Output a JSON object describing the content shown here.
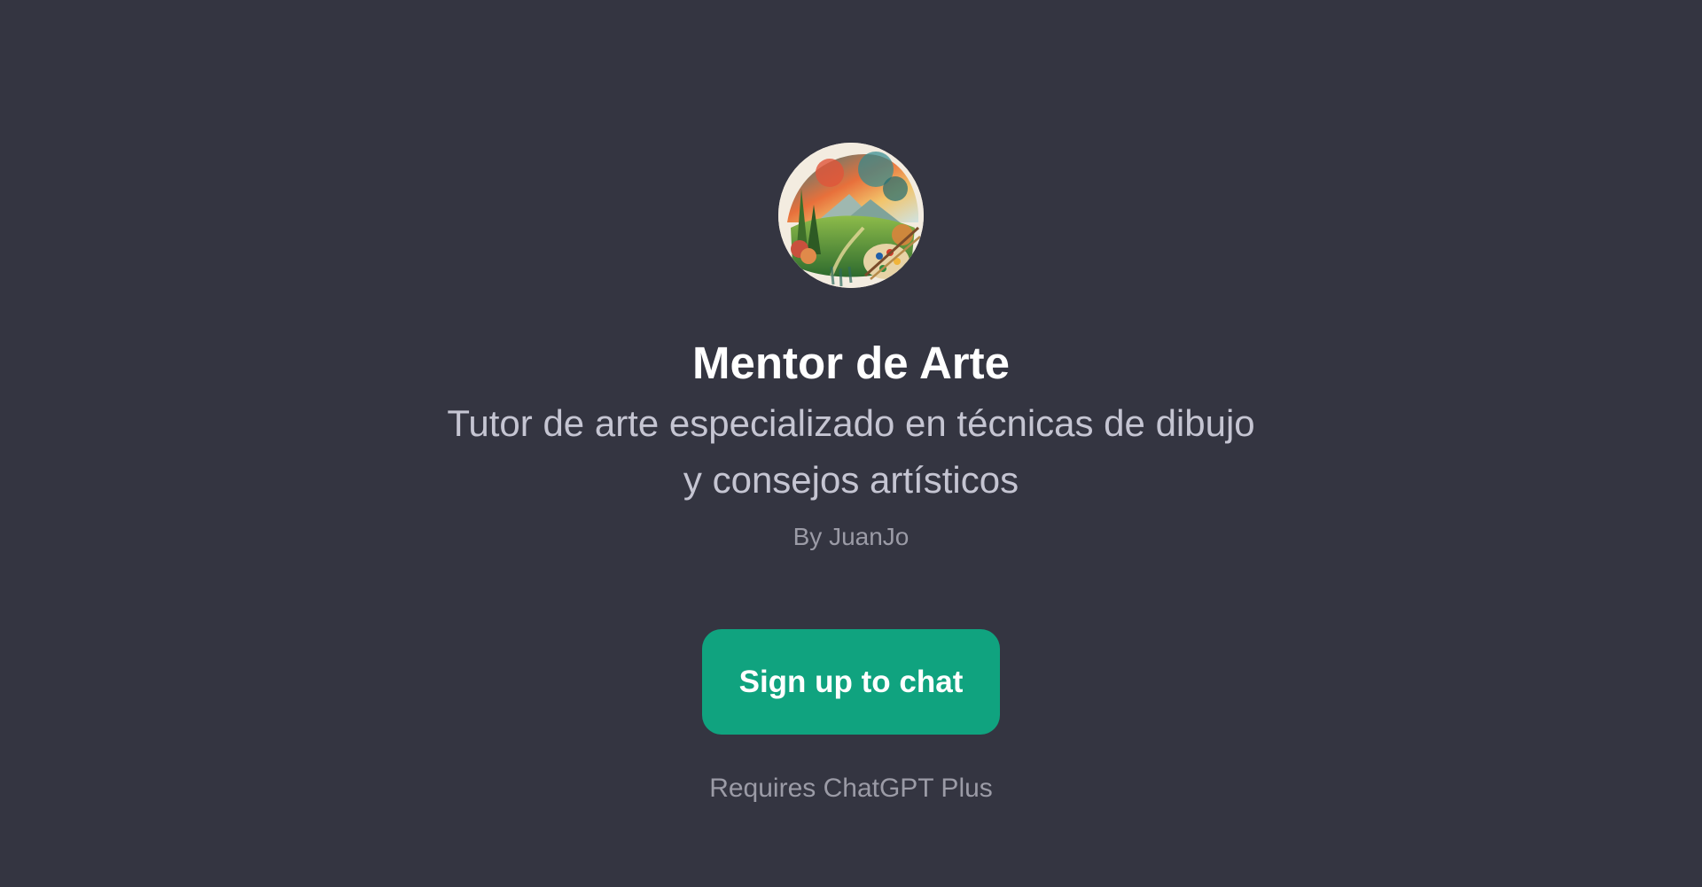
{
  "gpt": {
    "name": "Mentor de Arte",
    "description_line1": "Tutor de arte especializado en técnicas de dibujo",
    "description_line2": "y consejos artísticos",
    "author": "By JuanJo",
    "avatar_icon": "watercolor-landscape-palette-avatar"
  },
  "actions": {
    "signup_label": "Sign up to chat",
    "requirement_note": "Requires ChatGPT Plus"
  },
  "colors": {
    "background": "#343541",
    "button": "#10a37f",
    "title": "#ffffff",
    "description": "#c5c5d2",
    "muted": "#9b9ba6"
  }
}
